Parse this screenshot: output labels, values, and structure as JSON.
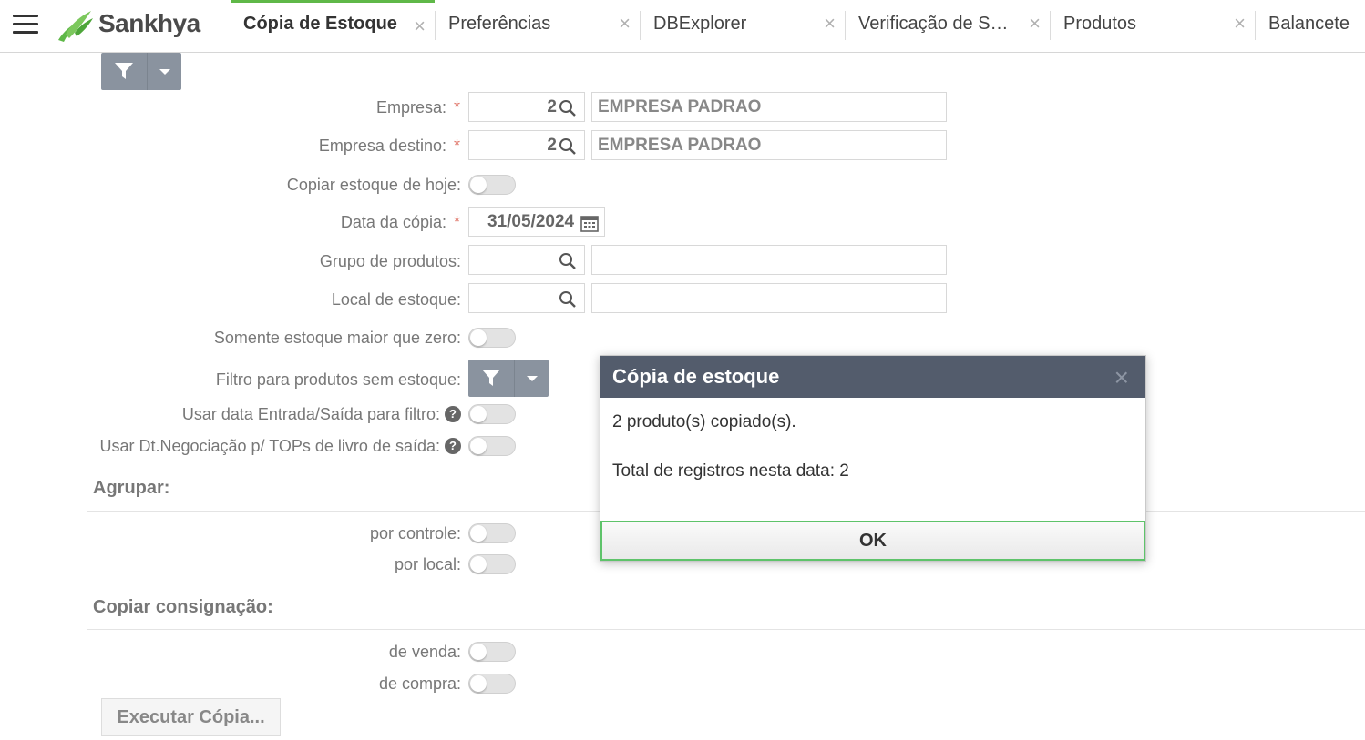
{
  "app": {
    "logo_text": "Sankhya",
    "brand_color": "#5fb848"
  },
  "tabs": [
    {
      "label": "Cópia de Estoque",
      "active": true
    },
    {
      "label": "Preferências"
    },
    {
      "label": "DBExplorer"
    },
    {
      "label": "Verificação de Sa…"
    },
    {
      "label": "Produtos"
    },
    {
      "label": "Balancete"
    }
  ],
  "form": {
    "empresa": {
      "label": "Empresa:",
      "code": "2",
      "name": "EMPRESA PADRAO"
    },
    "empresa_destino": {
      "label": "Empresa destino:",
      "code": "2",
      "name": "EMPRESA PADRAO"
    },
    "copiar_hoje": {
      "label": "Copiar estoque de hoje:"
    },
    "data_copia": {
      "label": "Data da cópia:",
      "value": "31/05/2024"
    },
    "grupo_produtos": {
      "label": "Grupo de produtos:"
    },
    "local_estoque": {
      "label": "Local de estoque:"
    },
    "somente_maior_zero": {
      "label": "Somente estoque maior que zero:"
    },
    "filtro_sem_estoque": {
      "label": "Filtro para produtos sem estoque:"
    },
    "usar_data_es": {
      "label": "Usar data Entrada/Saída para filtro:"
    },
    "usar_dt_negociacao": {
      "label": "Usar Dt.Negociação p/ TOPs de livro de saída:"
    },
    "agrupar": {
      "title": "Agrupar:",
      "por_controle": "por controle:",
      "por_local": "por local:"
    },
    "consignacao": {
      "title": "Copiar consignação:",
      "de_venda": "de venda:",
      "de_compra": "de compra:"
    },
    "executar_label": "Executar Cópia..."
  },
  "dialog": {
    "title": "Cópia de estoque",
    "line1": "2 produto(s) copiado(s).",
    "line2": "Total de registros nesta data: 2",
    "ok_label": "OK"
  }
}
